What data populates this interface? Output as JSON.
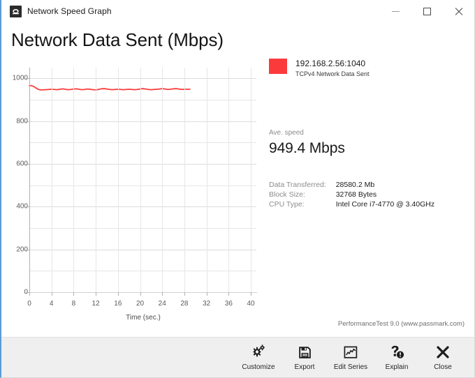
{
  "window": {
    "title": "Network Speed Graph",
    "app_icon": "network-adapter-icon",
    "controls": {
      "minimize": "Minimize",
      "maximize": "Maximize",
      "close": "Close"
    }
  },
  "page_title": "Network Data Sent (Mbps)",
  "legend": {
    "swatch_color": "#fb3b3b",
    "title": "192.168.2.56:1040",
    "subtitle": "TCPv4 Network Data Sent"
  },
  "average": {
    "label": "Ave. speed",
    "value": "949.4 Mbps"
  },
  "stats": [
    {
      "key": "Data Transferred:",
      "value": "28580.2 Mb"
    },
    {
      "key": "Block Size:",
      "value": "32768 Bytes"
    },
    {
      "key": "CPU Type:",
      "value": "Intel Core i7-4770 @ 3.40GHz"
    }
  ],
  "footer": "PerformanceTest 9.0 (www.passmark.com)",
  "toolbar": [
    {
      "label": "Customize",
      "icon": "gears-icon"
    },
    {
      "label": "Export",
      "icon": "floppy-disk-icon"
    },
    {
      "label": "Edit Series",
      "icon": "line-chart-icon"
    },
    {
      "label": "Explain",
      "icon": "question-mark-icon"
    },
    {
      "label": "Close",
      "icon": "close-x-icon"
    }
  ],
  "chart_data": {
    "type": "line",
    "title": "Network Data Sent (Mbps)",
    "xlabel": "Time (sec.)",
    "ylabel": "",
    "xlim": [
      0,
      41
    ],
    "ylim": [
      0,
      1050
    ],
    "xticks": [
      0,
      4,
      8,
      12,
      16,
      20,
      24,
      28,
      32,
      36,
      40
    ],
    "yticks": [
      0,
      200,
      400,
      600,
      800,
      1000
    ],
    "y_minor_step": 100,
    "grid": true,
    "legend_position": "right",
    "series": [
      {
        "name": "192.168.2.56:1040",
        "color": "#fb3b3b",
        "x": [
          0.0,
          0.3,
          0.6,
          0.9,
          1.2,
          1.5,
          1.8,
          2.1,
          2.4,
          2.7,
          3.0,
          3.5,
          4.0,
          4.5,
          5.0,
          5.5,
          6.0,
          6.5,
          7.0,
          7.5,
          8.0,
          8.5,
          9.0,
          9.5,
          10.0,
          10.5,
          11.0,
          11.5,
          12.0,
          12.5,
          13.0,
          13.5,
          14.0,
          14.5,
          15.0,
          15.5,
          16.0,
          16.5,
          17.0,
          17.5,
          18.0,
          18.5,
          19.0,
          19.5,
          20.0,
          20.5,
          21.0,
          21.5,
          22.0,
          22.5,
          23.0,
          23.5,
          24.0,
          24.5,
          25.0,
          25.5,
          26.0,
          26.5,
          27.0,
          27.5,
          28.0,
          28.5,
          29.0
        ],
        "y": [
          966,
          966,
          964,
          960,
          955,
          950,
          947,
          946,
          946,
          947,
          947,
          948,
          949,
          948,
          947,
          949,
          951,
          949,
          947,
          948,
          950,
          951,
          949,
          947,
          948,
          950,
          949,
          947,
          946,
          948,
          951,
          952,
          950,
          948,
          947,
          948,
          949,
          948,
          947,
          948,
          949,
          948,
          947,
          948,
          950,
          952,
          950,
          948,
          947,
          948,
          949,
          950,
          952,
          950,
          948,
          949,
          951,
          952,
          950,
          948,
          949,
          949,
          949
        ]
      }
    ]
  }
}
